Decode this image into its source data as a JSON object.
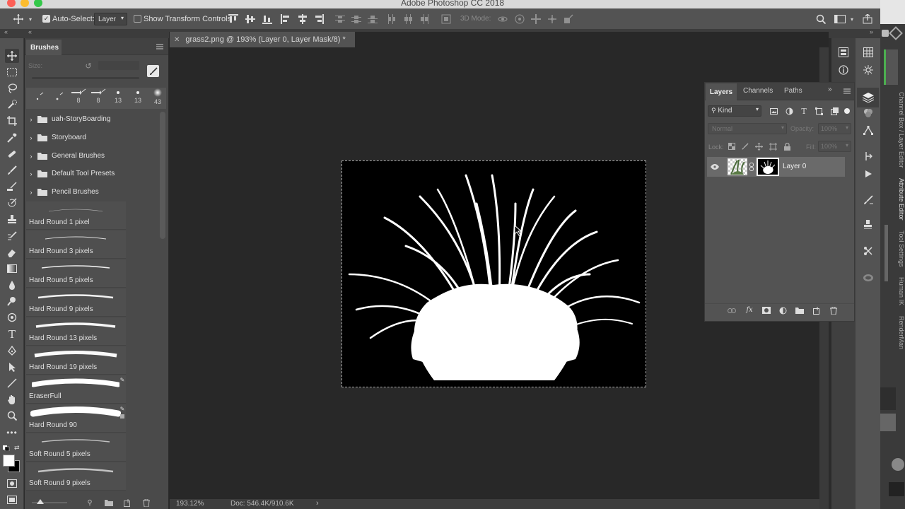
{
  "app": {
    "title": "Adobe Photoshop CC 2018"
  },
  "options_bar": {
    "auto_select_label": "Auto-Select:",
    "auto_select_value": "Layer",
    "transform_label": "Show Transform Controls",
    "mode_3d_label": "3D Mode:"
  },
  "brushes_panel": {
    "title": "Brushes",
    "size_label": "Size:",
    "presets": [
      "8",
      "8",
      "13",
      "13",
      "43"
    ],
    "folders": [
      {
        "label": "uah-StoryBoarding"
      },
      {
        "label": "Storyboard"
      },
      {
        "label": "General Brushes"
      },
      {
        "label": "Default Tool Presets"
      },
      {
        "label": "Pencil Brushes"
      }
    ],
    "brushes": [
      {
        "label": "Hard Round 1 pixel"
      },
      {
        "label": "Hard Round 3 pixels"
      },
      {
        "label": "Hard Round 5 pixels"
      },
      {
        "label": "Hard Round 9 pixels"
      },
      {
        "label": "Hard Round 13 pixels"
      },
      {
        "label": "Hard Round 19 pixels"
      },
      {
        "label": "EraserFull"
      },
      {
        "label": "Hard Round 90"
      },
      {
        "label": "Soft Round 5 pixels"
      },
      {
        "label": "Soft Round 9 pixels"
      }
    ]
  },
  "document": {
    "tab_title": "grass2.png @ 193% (Layer 0, Layer Mask/8) *",
    "zoom": "193.12%",
    "doc_size": "Doc: 546.4K/910.6K"
  },
  "layers_panel": {
    "tabs": [
      "Layers",
      "Channels",
      "Paths"
    ],
    "filter_label": "Kind",
    "blend_mode": "Normal",
    "opacity_label": "Opacity:",
    "opacity_value": "100%",
    "lock_label": "Lock:",
    "fill_label": "Fill:",
    "fill_value": "100%",
    "layer_name": "Layer 0"
  },
  "right_side_labels": [
    "Channel Box / Layer Editor",
    "Attribute Editor",
    "Tool Settings",
    "Human IK",
    "RenderMan"
  ]
}
